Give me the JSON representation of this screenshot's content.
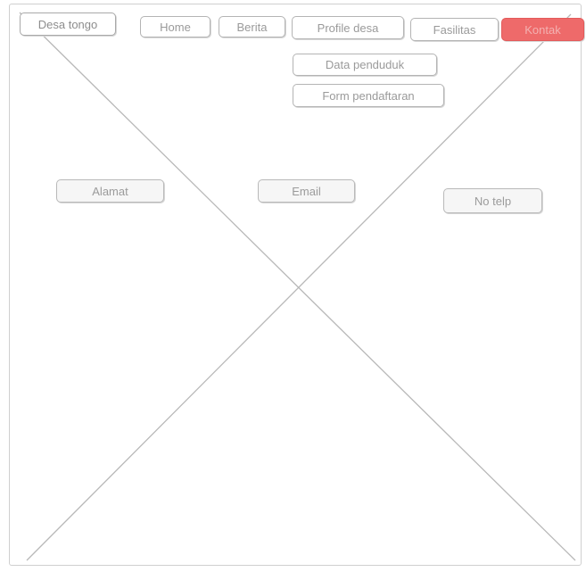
{
  "brand": {
    "label": "Desa tongo"
  },
  "nav": {
    "home": "Home",
    "berita": "Berita",
    "profile_desa": "Profile desa",
    "fasilitas": "Fasilitas",
    "kontak": "Kontak"
  },
  "dropdown": {
    "data_penduduk": "Data penduduk",
    "form_pendaftaran": "Form pendaftaran"
  },
  "contact": {
    "alamat": "Alamat",
    "email": "Email",
    "no_telp": "No telp"
  },
  "colors": {
    "active_nav": "#ee6a6a",
    "outline": "#b4b4b4",
    "text": "#9a9a9a"
  }
}
